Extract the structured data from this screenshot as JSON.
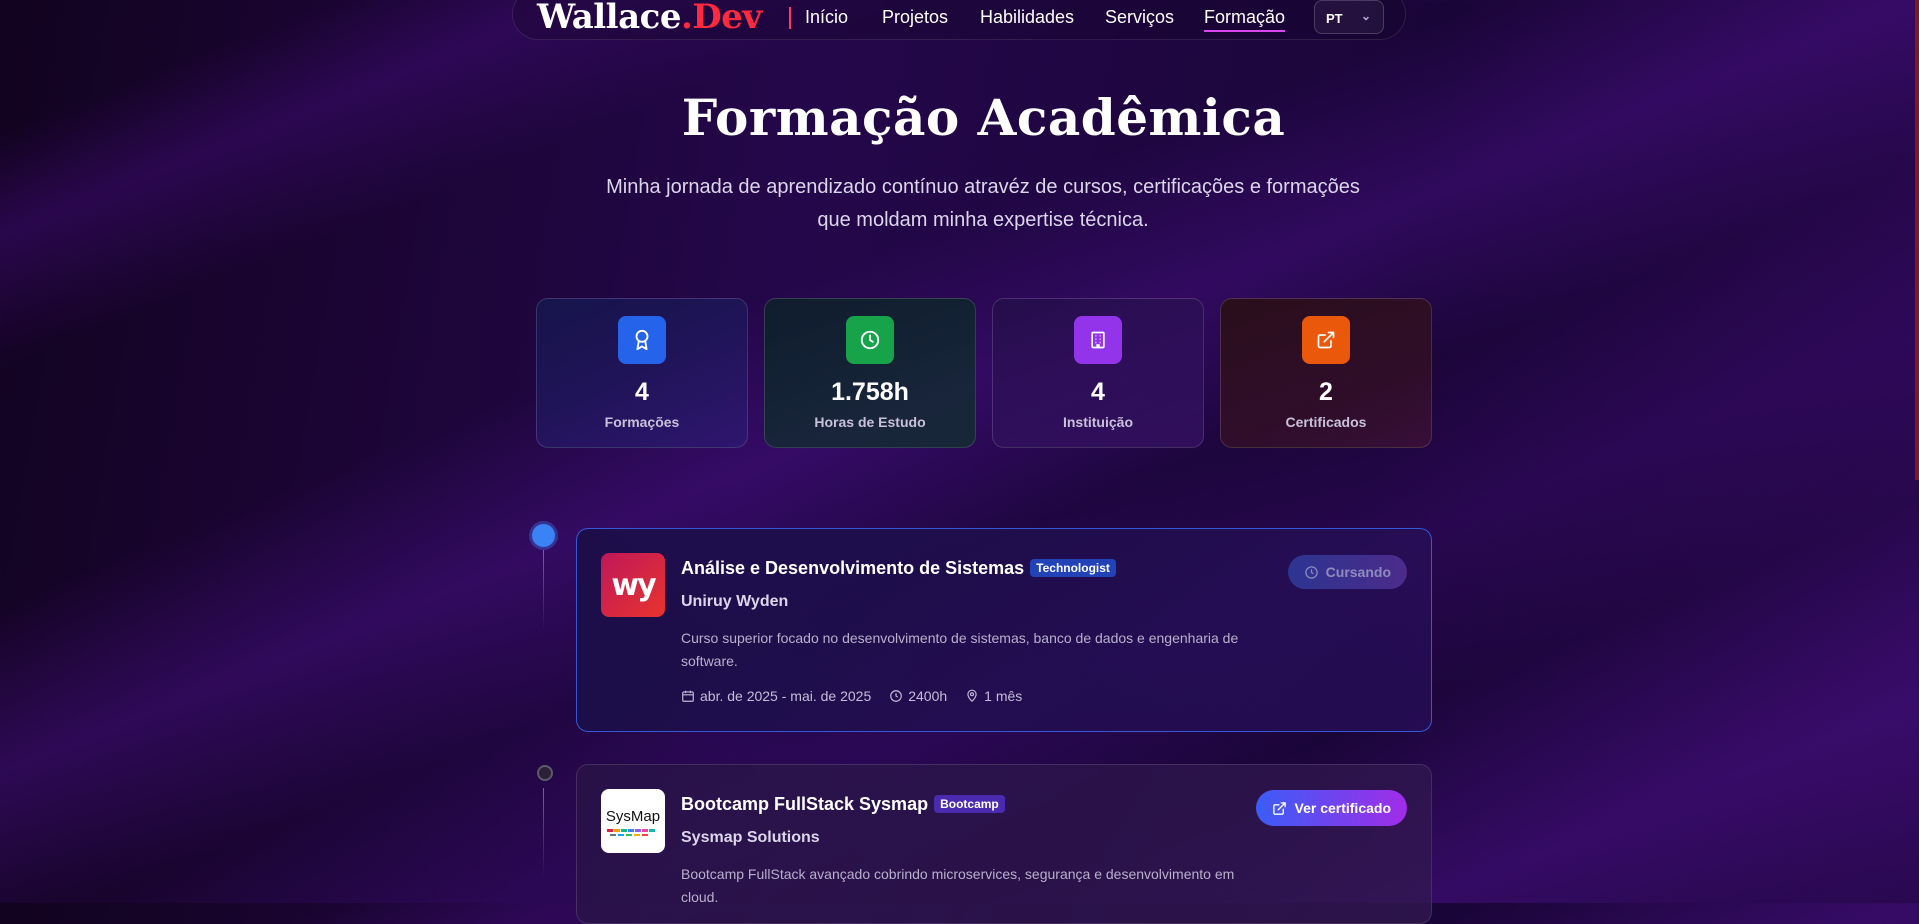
{
  "nav": {
    "brand_main": "Wallace",
    "brand_accent": ".Dev",
    "links": [
      "Início",
      "Projetos",
      "Habilidades",
      "Serviços",
      "Formação"
    ],
    "active": "Formação",
    "language": "PT"
  },
  "hero": {
    "title": "Formação Acadêmica",
    "subtitle": "Minha jornada de aprendizado contínuo atravéz de cursos, certificações e formações que moldam minha expertise técnica."
  },
  "stats": [
    {
      "icon": "award-icon",
      "value": "4",
      "label": "Formações",
      "color": "#2563eb"
    },
    {
      "icon": "clock-icon",
      "value": "1.758h",
      "label": "Horas de Estudo",
      "color": "#16a34a"
    },
    {
      "icon": "building-icon",
      "value": "4",
      "label": "Instituição",
      "color": "#9333ea"
    },
    {
      "icon": "external-link-icon",
      "value": "2",
      "label": "Certificados",
      "color": "#ea580c"
    }
  ],
  "education": [
    {
      "title": "Análise e Desenvolvimento de Sistemas",
      "badge": "Technologist",
      "institution": "Uniruy Wyden",
      "logo_text": "wy",
      "description": "Curso superior focado no desenvolvimento de sistemas, banco de dados e engenharia de software.",
      "period": "abr. de 2025 - mai. de 2025",
      "hours": "2400h",
      "duration": "1 mês",
      "status": "Cursando"
    },
    {
      "title": "Bootcamp FullStack Sysmap",
      "badge": "Bootcamp",
      "institution": "Sysmap Solutions",
      "logo_text": "SysMap",
      "description": "Bootcamp FullStack avançado cobrindo microservices, segurança e desenvolvimento em cloud.",
      "action": "Ver certificado"
    }
  ]
}
